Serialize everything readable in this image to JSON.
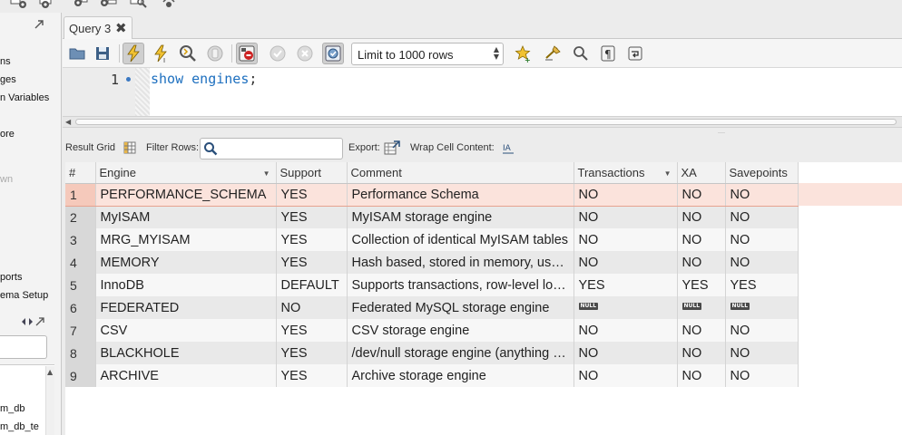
{
  "top_toolbar": {
    "icons": [
      "sql-new-icon",
      "sql-open-icon",
      "db-add-icon",
      "db-table-icon",
      "db-view-icon",
      "reconnect-icon"
    ]
  },
  "sidebar": {
    "fragments": [
      {
        "text": "ns",
        "style": "normal"
      },
      {
        "text": "ges",
        "style": "normal"
      },
      {
        "text": "n Variables",
        "style": "normal"
      },
      {
        "text": "ore",
        "style": "normal"
      },
      {
        "text": "wn",
        "style": "gray"
      },
      {
        "text": "ports",
        "style": "normal"
      },
      {
        "text": "ema Setup",
        "style": "normal"
      },
      {
        "text": "m_db",
        "style": "normal"
      },
      {
        "text": "m_db_te",
        "style": "normal"
      }
    ]
  },
  "tab": {
    "label": "Query 3",
    "close": "✖"
  },
  "toolbar": {
    "limit": "Limit to 1000 rows"
  },
  "editor": {
    "line_number": "1",
    "code_keyword": "show engines",
    "code_punct": ";"
  },
  "results": {
    "result_grid_label": "Result Grid",
    "filter_label": "Filter Rows:",
    "filter_value": "",
    "export_label": "Export:",
    "wrap_label": "Wrap Cell Content:",
    "columns": [
      "#",
      "Engine",
      "Support",
      "Comment",
      "Transactions",
      "XA",
      "Savepoints"
    ],
    "rows": [
      {
        "n": "1",
        "engine": "PERFORMANCE_SCHEMA",
        "support": "YES",
        "comment": "Performance Schema",
        "transactions": "NO",
        "xa": "NO",
        "savepoints": "NO",
        "selected": true
      },
      {
        "n": "2",
        "engine": "MyISAM",
        "support": "YES",
        "comment": "MyISAM storage engine",
        "transactions": "NO",
        "xa": "NO",
        "savepoints": "NO"
      },
      {
        "n": "3",
        "engine": "MRG_MYISAM",
        "support": "YES",
        "comment": "Collection of identical MyISAM tables",
        "transactions": "NO",
        "xa": "NO",
        "savepoints": "NO"
      },
      {
        "n": "4",
        "engine": "MEMORY",
        "support": "YES",
        "comment": "Hash based, stored in memory, useful for temporary tables",
        "transactions": "NO",
        "xa": "NO",
        "savepoints": "NO"
      },
      {
        "n": "5",
        "engine": "InnoDB",
        "support": "DEFAULT",
        "comment": "Supports transactions, row-level locking, and foreign keys",
        "transactions": "YES",
        "xa": "YES",
        "savepoints": "YES"
      },
      {
        "n": "6",
        "engine": "FEDERATED",
        "support": "NO",
        "comment": "Federated MySQL storage engine",
        "transactions": "NULL",
        "xa": "NULL",
        "savepoints": "NULL"
      },
      {
        "n": "7",
        "engine": "CSV",
        "support": "YES",
        "comment": "CSV storage engine",
        "transactions": "NO",
        "xa": "NO",
        "savepoints": "NO"
      },
      {
        "n": "8",
        "engine": "BLACKHOLE",
        "support": "YES",
        "comment": "/dev/null storage engine (anything you write to it disappears)",
        "transactions": "NO",
        "xa": "NO",
        "savepoints": "NO"
      },
      {
        "n": "9",
        "engine": "ARCHIVE",
        "support": "YES",
        "comment": "Archive storage engine",
        "transactions": "NO",
        "xa": "NO",
        "savepoints": "NO"
      }
    ]
  },
  "colors": {
    "selection_bg": "#fbe3dc",
    "selection_border": "#e7a28f",
    "keyword": "#1d6fbf",
    "null_badge": "#4a4a4a"
  }
}
